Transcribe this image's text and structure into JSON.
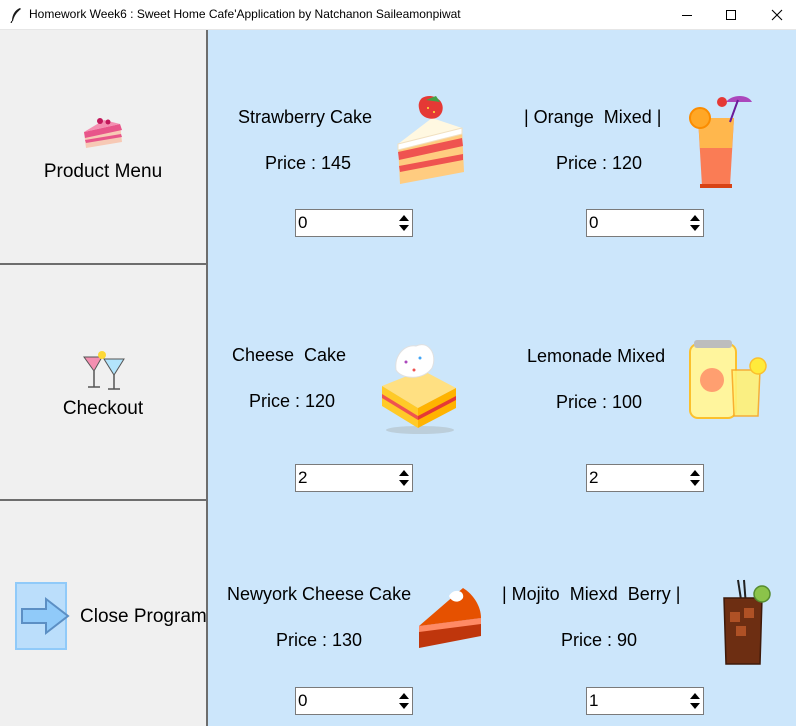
{
  "window": {
    "title": "Homework Week6 : Sweet Home Cafe'Application by Natchanon Saileamonpiwat"
  },
  "sidebar": {
    "items": [
      {
        "label": "Product Menu",
        "icon": "cake-slice-icon"
      },
      {
        "label": "Checkout",
        "icon": "cocktail-glasses-icon"
      },
      {
        "label": "Close Program",
        "icon": "exit-arrow-icon"
      }
    ]
  },
  "products": [
    {
      "name": "Strawberry Cake",
      "price": "Price : 145",
      "qty": "0",
      "icon": "strawberry-cake-icon"
    },
    {
      "name": "| Orange  Mixed |",
      "price": "Price : 120",
      "qty": "0",
      "icon": "orange-drink-icon"
    },
    {
      "name": "Cheese  Cake",
      "price": "Price : 120",
      "qty": "2",
      "icon": "cheese-cake-icon"
    },
    {
      "name": "Lemonade Mixed",
      "price": "Price : 100",
      "qty": "2",
      "icon": "lemonade-icon"
    },
    {
      "name": "Newyork Cheese Cake",
      "price": "Price : 130",
      "qty": "0",
      "icon": "pie-slice-icon"
    },
    {
      "name": "| Mojito  Miexd  Berry |",
      "price": "Price : 90",
      "qty": "1",
      "icon": "mojito-icon"
    }
  ],
  "colors": {
    "main_background": "#cce6fb",
    "sidebar_background": "#f0f0f0"
  }
}
